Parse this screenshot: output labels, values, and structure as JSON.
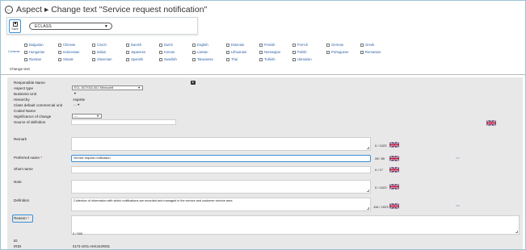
{
  "header": {
    "back_icon": "back-arrow-icon",
    "title": "Aspect ▸ Change text \"Service request notification\""
  },
  "toolbar": {
    "save_label": "Save",
    "class_select": "ECLASS"
  },
  "languages": {
    "contents_label": "Contents",
    "row1": [
      "Bulgarian",
      "Chinese",
      "Czech",
      "Danish",
      "Dutch",
      "English",
      "Estonian",
      "Finnish",
      "French",
      "German",
      "Greek"
    ],
    "row2": [
      "Hungarian",
      "Indonesian",
      "Italian",
      "Japanese",
      "Korean",
      "Latvian",
      "Lithuanian",
      "Norwegian",
      "Polish",
      "Portuguese",
      "Romanian"
    ],
    "row3": [
      "Russian",
      "Slovak",
      "Slovenian",
      "Spanish",
      "Swedish",
      "Taiwanese",
      "Thai",
      "Turkish",
      "Ukrainian"
    ]
  },
  "tabs": {
    "change_text": "Change text"
  },
  "form": {
    "responsible_name": {
      "label": "Responsible Name"
    },
    "aspect_type": {
      "label": "Aspect type",
      "value": "ECL-SGT002-001 Teilmodell"
    },
    "business_unit": {
      "label": "Business Unit"
    },
    "hierarchy": {
      "label": "Hierarchy",
      "value": "Aspekte"
    },
    "class_default": {
      "label": "Class default commercial unit",
      "value": "---"
    },
    "coded_name": {
      "label": "Coded Name"
    },
    "significance": {
      "label": "Significance of change",
      "value": "---"
    },
    "source": {
      "label": "Source of definition"
    },
    "remark": {
      "label": "Remark",
      "counter": "0 / 1023"
    },
    "preferred_name": {
      "label": "Preferred name",
      "value": "Service request notification",
      "counter": "28 / 80"
    },
    "short_name": {
      "label": "Short name",
      "counter": "0 / 17"
    },
    "note": {
      "label": "Note",
      "counter": "0 / 1023"
    },
    "definition": {
      "label": "Definition",
      "value": "Collection of information with which notifications are recorded and managed in the service and customer service area",
      "counter": "116 / 1023"
    },
    "reason": {
      "label": "Reason",
      "counter": "0 / 500"
    },
    "id": {
      "label": "ID"
    },
    "irdi": {
      "label": "IRDI",
      "value": "0173-1#01-AKK443#001"
    },
    "required_marker": "*"
  },
  "colors": {
    "accent": "#3a8fd8",
    "form_bg": "#e8e8e8",
    "link": "#2b5fa8"
  }
}
